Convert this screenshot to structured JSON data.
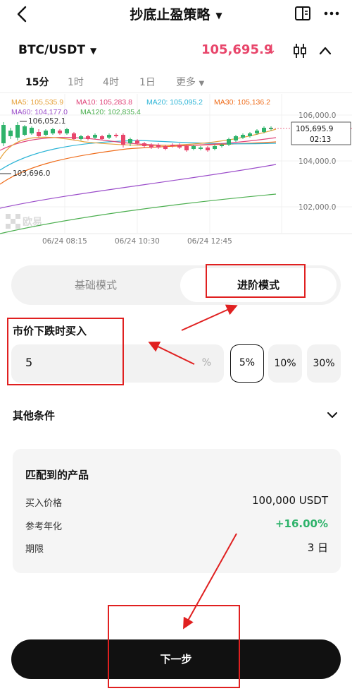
{
  "header": {
    "title": "抄底止盈策略"
  },
  "pair": {
    "name": "BTC/USDT",
    "price": "105,695.9",
    "price_color": "#e8466b"
  },
  "timeframes": [
    "15分",
    "1时",
    "4时",
    "1日",
    "更多"
  ],
  "chart": {
    "ma_labels": {
      "ma5": "MA5: 105,535.9",
      "ma10": "MA10: 105,283.8",
      "ma20": "MA20: 105,095.2",
      "ma30": "MA30: 105,136.2",
      "ma60": "MA60: 104,177.0",
      "ma120": "MA120: 102,835.4"
    },
    "ma_colors": {
      "ma5": "#e6a23c",
      "ma10": "#e0457b",
      "ma20": "#2bb4d6",
      "ma30": "#ef6c1a",
      "ma60": "#9b4dca",
      "ma120": "#4caf50"
    },
    "price_ticks": [
      "106,000.0",
      "104,000.0",
      "102,000.0"
    ],
    "time_ticks": [
      "06/24 08:15",
      "06/24 10:30",
      "06/24 12:45"
    ],
    "high_marker": "106,052.1",
    "low_marker": "103,696.0",
    "current_price": "105,695.9",
    "countdown": "02:13",
    "watermark": "欧易",
    "up_color": "#2fb36b",
    "down_color": "#e8466b"
  },
  "mode": {
    "basic": "基础模式",
    "advanced": "进阶模式"
  },
  "buy_condition": {
    "label": "市价下跌时买入",
    "value": "5",
    "unit": "%",
    "presets": [
      "5%",
      "10%",
      "30%"
    ]
  },
  "other": {
    "label": "其他条件"
  },
  "matched": {
    "title": "匹配到的产品",
    "rows": [
      {
        "key": "买入价格",
        "value": "100,000 USDT"
      },
      {
        "key": "参考年化",
        "value": "+16.00%"
      },
      {
        "key": "期限",
        "value": "3 日"
      }
    ]
  },
  "next_button": "下一步",
  "annotation_color": "#e02020"
}
